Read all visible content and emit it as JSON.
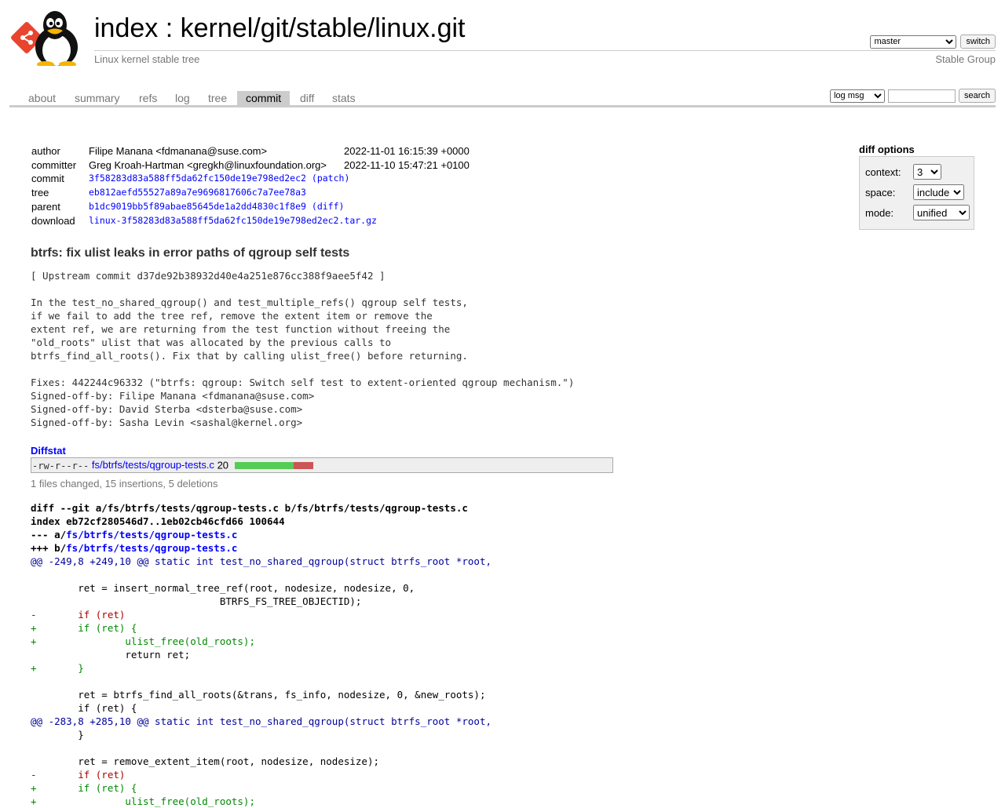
{
  "header": {
    "title": "index : kernel/git/stable/linux.git",
    "description": "Linux kernel stable tree",
    "owner": "Stable Group",
    "branch": {
      "selected": "master",
      "switch_label": "switch"
    }
  },
  "tabs": [
    {
      "label": "about"
    },
    {
      "label": "summary"
    },
    {
      "label": "refs"
    },
    {
      "label": "log"
    },
    {
      "label": "tree"
    },
    {
      "label": "commit",
      "active": true
    },
    {
      "label": "diff"
    },
    {
      "label": "stats"
    }
  ],
  "search": {
    "type": "log msg",
    "value": "",
    "button_label": "search"
  },
  "commit_info": {
    "author": {
      "label": "author",
      "name": "Filipe Manana <fdmanana@suse.com>",
      "date": "2022-11-01 16:15:39 +0000"
    },
    "committer": {
      "label": "committer",
      "name": "Greg Kroah-Hartman <gregkh@linuxfoundation.org>",
      "date": "2022-11-10 15:47:21 +0100"
    },
    "commit": {
      "label": "commit",
      "hash": "3f58283d83a588ff5da62fc150de19e798ed2ec2",
      "extra": "patch"
    },
    "tree": {
      "label": "tree",
      "hash": "eb812aefd55527a89a7e9696817606c7a7ee78a3"
    },
    "parent": {
      "label": "parent",
      "hash": "b1dc9019bb5f89abae85645de1a2dd4830c1f8e9",
      "extra": "diff"
    },
    "download": {
      "label": "download",
      "file": "linux-3f58283d83a588ff5da62fc150de19e798ed2ec2.tar.gz"
    }
  },
  "diff_options": {
    "title": "diff options",
    "context": {
      "label": "context:",
      "value": "3"
    },
    "space": {
      "label": "space:",
      "value": "include"
    },
    "mode": {
      "label": "mode:",
      "value": "unified"
    }
  },
  "commit_subject": "btrfs: fix ulist leaks in error paths of qgroup self tests",
  "commit_message": [
    "[ Upstream commit d37de92b38932d40e4a251e876cc388f9aee5f42 ]",
    "",
    "In the test_no_shared_qgroup() and test_multiple_refs() qgroup self tests,",
    "if we fail to add the tree ref, remove the extent item or remove the",
    "extent ref, we are returning from the test function without freeing the",
    "\"old_roots\" ulist that was allocated by the previous calls to",
    "btrfs_find_all_roots(). Fix that by calling ulist_free() before returning.",
    "",
    "Fixes: 442244c96332 (\"btrfs: qgroup: Switch self test to extent-oriented qgroup mechanism.\")",
    "Signed-off-by: Filipe Manana <fdmanana@suse.com>",
    "Signed-off-by: David Sterba <dsterba@suse.com>",
    "Signed-off-by: Sasha Levin <sashal@kernel.org>"
  ],
  "diffstat": {
    "title": "Diffstat",
    "mode": "-rw-r--r--",
    "file": "fs/btrfs/tests/qgroup-tests.c",
    "count": "20",
    "insertions": 15,
    "deletions": 5,
    "summary": "1 files changed, 15 insertions, 5 deletions"
  },
  "diff_lines": [
    {
      "type": "head",
      "text": "diff --git a/fs/btrfs/tests/qgroup-tests.c b/fs/btrfs/tests/qgroup-tests.c"
    },
    {
      "type": "head",
      "text": "index eb72cf280546d7..1eb02cb46cfd66 100644"
    },
    {
      "type": "head",
      "prefix": "--- a/",
      "link": "fs/btrfs/tests/qgroup-tests.c"
    },
    {
      "type": "head",
      "prefix": "+++ b/",
      "link": "fs/btrfs/tests/qgroup-tests.c"
    },
    {
      "type": "hunk",
      "range": "@@ -249,8 +249,10 @@",
      "fn": " static int test_no_shared_qgroup(struct btrfs_root *root,"
    },
    {
      "type": "ctx",
      "text": ""
    },
    {
      "type": "ctx",
      "text": " \tret = insert_normal_tree_ref(root, nodesize, nodesize, 0,"
    },
    {
      "type": "ctx",
      "text": " \t\t\t\tBTRFS_FS_TREE_OBJECTID);"
    },
    {
      "type": "del",
      "text": "-\tif (ret)"
    },
    {
      "type": "add",
      "text": "+\tif (ret) {"
    },
    {
      "type": "add",
      "text": "+\t\tulist_free(old_roots);"
    },
    {
      "type": "ctx",
      "text": " \t\treturn ret;"
    },
    {
      "type": "add",
      "text": "+\t}"
    },
    {
      "type": "ctx",
      "text": ""
    },
    {
      "type": "ctx",
      "text": " \tret = btrfs_find_all_roots(&trans, fs_info, nodesize, 0, &new_roots);"
    },
    {
      "type": "ctx",
      "text": " \tif (ret) {"
    },
    {
      "type": "hunk",
      "range": "@@ -283,8 +285,10 @@",
      "fn": " static int test_no_shared_qgroup(struct btrfs_root *root,"
    },
    {
      "type": "ctx",
      "text": " \t}"
    },
    {
      "type": "ctx",
      "text": ""
    },
    {
      "type": "ctx",
      "text": " \tret = remove_extent_item(root, nodesize, nodesize);"
    },
    {
      "type": "del",
      "text": "-\tif (ret)"
    },
    {
      "type": "add",
      "text": "+\tif (ret) {"
    },
    {
      "type": "add",
      "text": "+\t\tulist_free(old_roots);"
    }
  ]
}
